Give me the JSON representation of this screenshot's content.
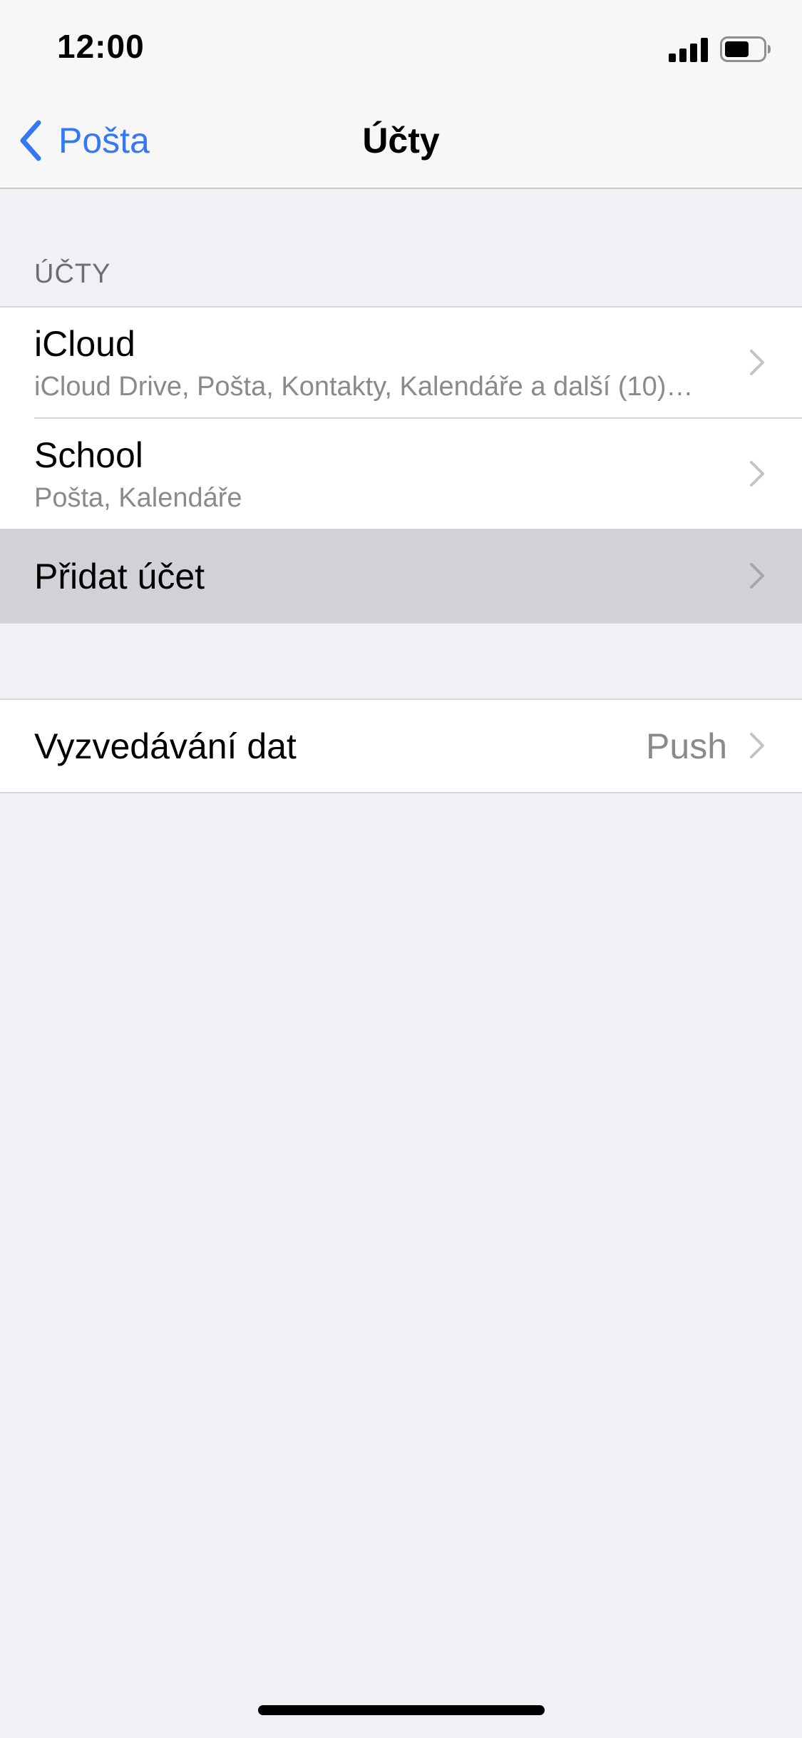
{
  "status_bar": {
    "time": "12:00",
    "icons": [
      "cellular-signal-icon",
      "battery-icon"
    ]
  },
  "nav": {
    "back_label": "Pošta",
    "back_icon": "chevron-left-icon",
    "title": "Účty",
    "accent_color": "#3478f6"
  },
  "accounts_section": {
    "header": "ÚČTY",
    "items": [
      {
        "title": "iCloud",
        "subtitle": "iCloud Drive, Pošta, Kontakty, Kalendáře a další (10)…"
      },
      {
        "title": "School",
        "subtitle": "Pošta, Kalendáře"
      },
      {
        "title": "Přidat účet",
        "selected": true
      }
    ]
  },
  "fetch_section": {
    "title": "Vyzvedávání dat",
    "value": "Push"
  }
}
